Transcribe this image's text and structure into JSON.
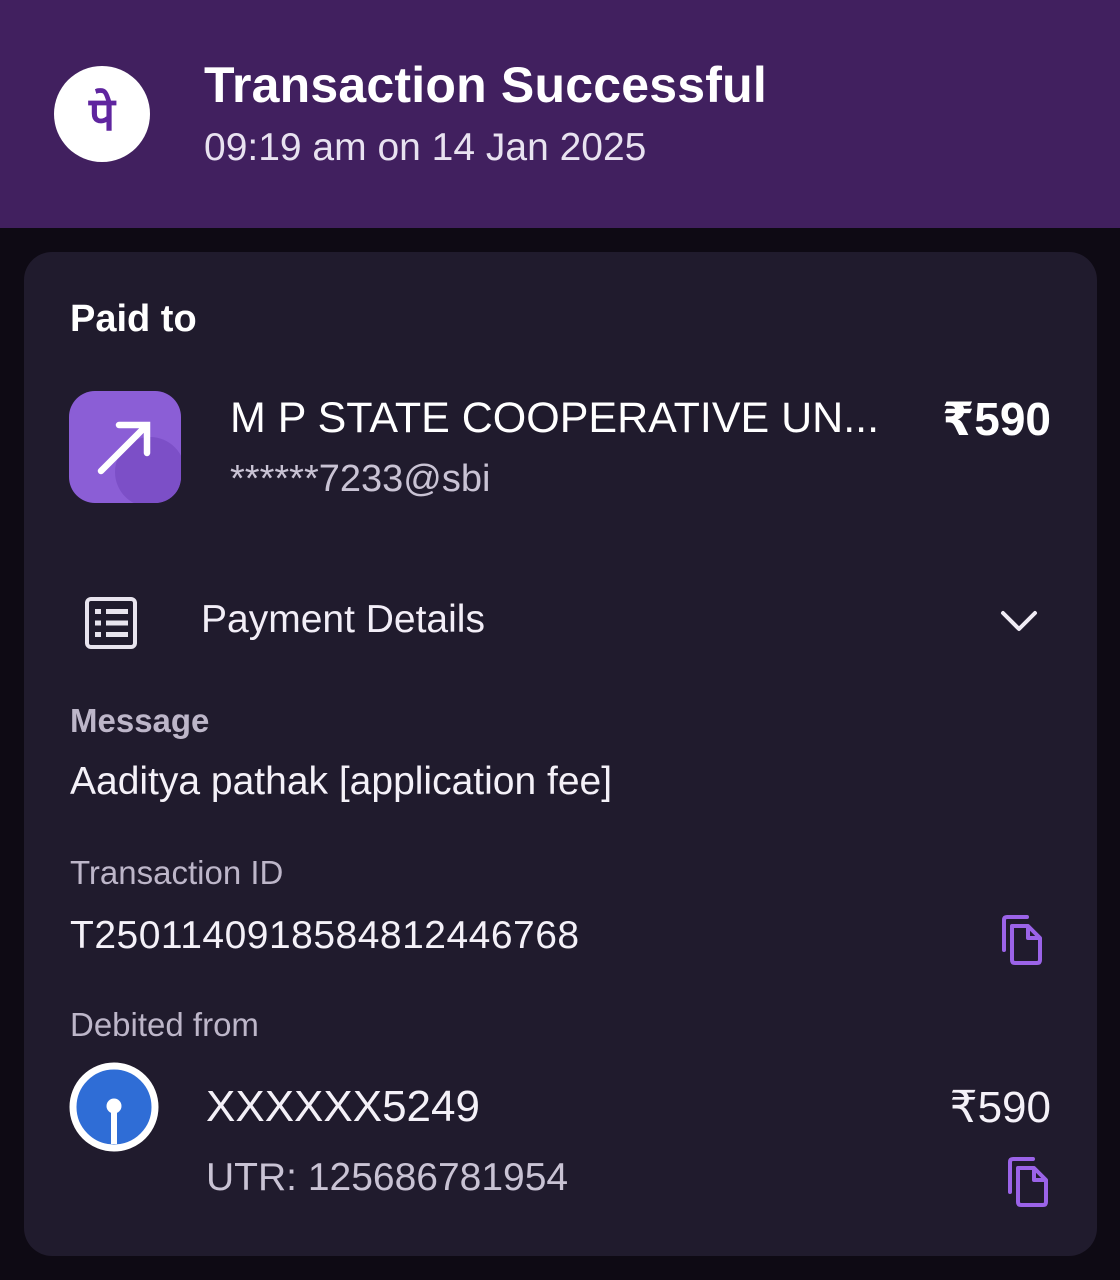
{
  "header": {
    "logo_glyph": "पे",
    "title": "Transaction Successful",
    "timestamp": "09:19 am on 14 Jan 2025",
    "background_color": "#41205f"
  },
  "paid_to": {
    "label": "Paid to",
    "payee_name": "M P STATE COOPERATIVE UN...",
    "payee_upi": "******7233@sbi",
    "amount": "₹590",
    "icon": "arrow-up-right-icon",
    "icon_color": "#8b5ed6"
  },
  "payment_details": {
    "label": "Payment Details",
    "icon": "receipt-list-icon",
    "toggle_icon": "chevron-down-icon"
  },
  "message": {
    "label": "Message",
    "value": "Aaditya pathak [application fee]"
  },
  "transaction": {
    "label": "Transaction ID",
    "value": "T2501140918584812446768",
    "copy_icon": "copy-icon"
  },
  "debited_from": {
    "label": "Debited from",
    "bank_icon": "sbi-bank-logo-icon",
    "account": "XXXXXX5249",
    "amount": "₹590",
    "utr": "UTR: 125686781954",
    "copy_icon": "copy-icon"
  },
  "colors": {
    "accent": "#9b63e8",
    "card": "#201b2d",
    "page": "#0e0a14"
  }
}
